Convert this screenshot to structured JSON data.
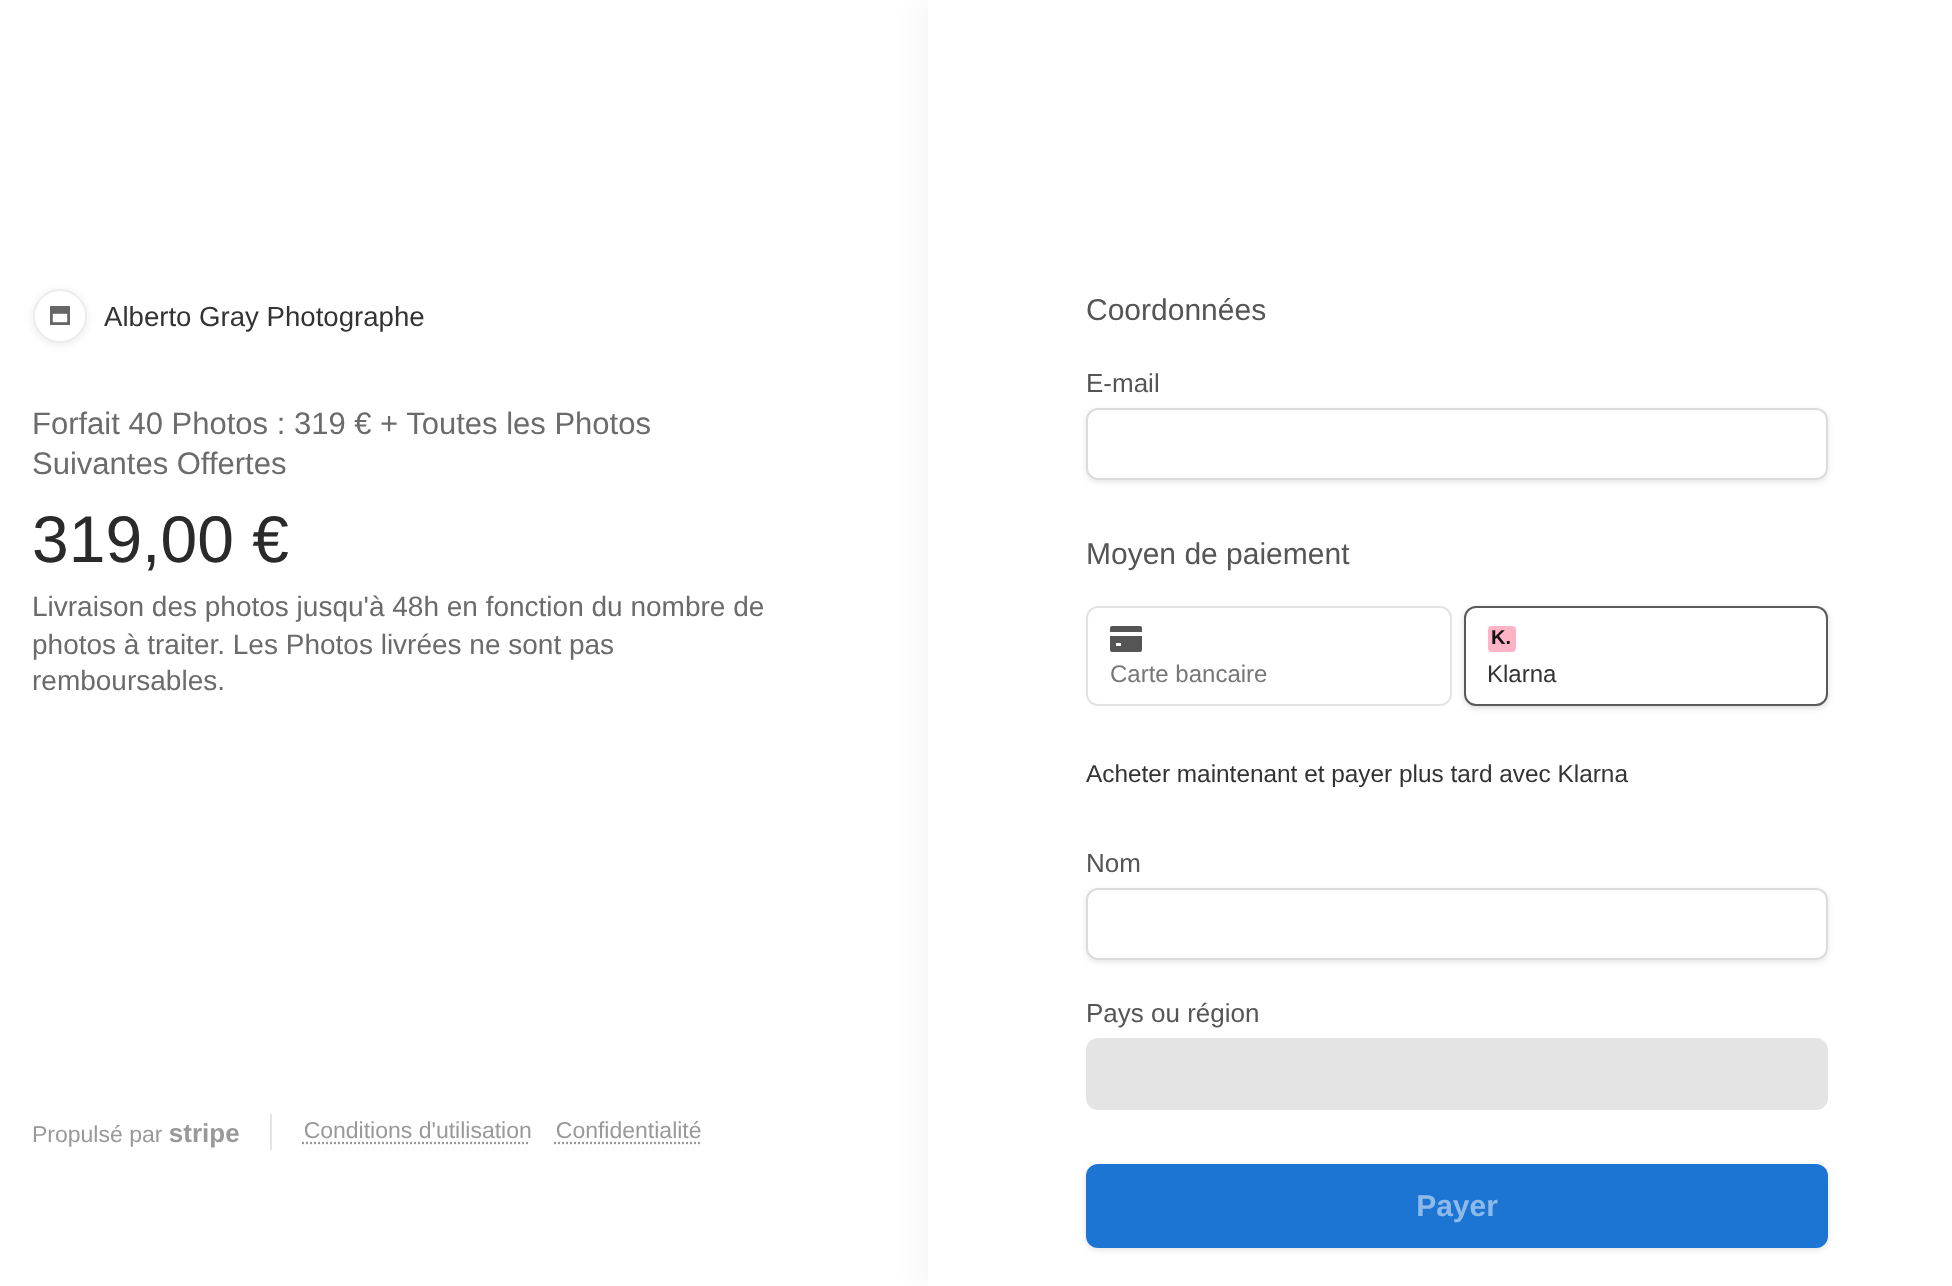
{
  "merchant": {
    "name": "Alberto Gray Photographe"
  },
  "product": {
    "title": "Forfait 40 Photos : 319 € + Toutes les Photos Suivantes Offertes",
    "price": "319,00 €",
    "description": "Livraison des photos jusqu'à 48h en fonction du nombre de photos à traiter. Les Photos livrées ne sont pas remboursables."
  },
  "footer": {
    "powered_by": "Propulsé par **stripe**",
    "links": [
      "Conditions d'utilisation",
      "Confidentialité"
    ]
  },
  "contact": {
    "heading": "Coordonnées",
    "email": {
      "label": "E-mail"
    }
  },
  "payment": {
    "heading": "Moyen de paiement",
    "methods": [
      {
        "kind": "card",
        "label": "Carte bancaire",
        "selected": false
      },
      {
        "kind": "klarna",
        "badge": "K.",
        "label": "Klarna",
        "selected": true
      }
    ],
    "note": "Acheter maintenant et payer plus tard avec Klarna"
  },
  "fields": [
    {
      "label": "Nom",
      "disabled": false
    },
    {
      "label": "Pays ou région",
      "disabled": true
    }
  ],
  "pay_button": {
    "label": "Payer",
    "disabled": true
  }
}
